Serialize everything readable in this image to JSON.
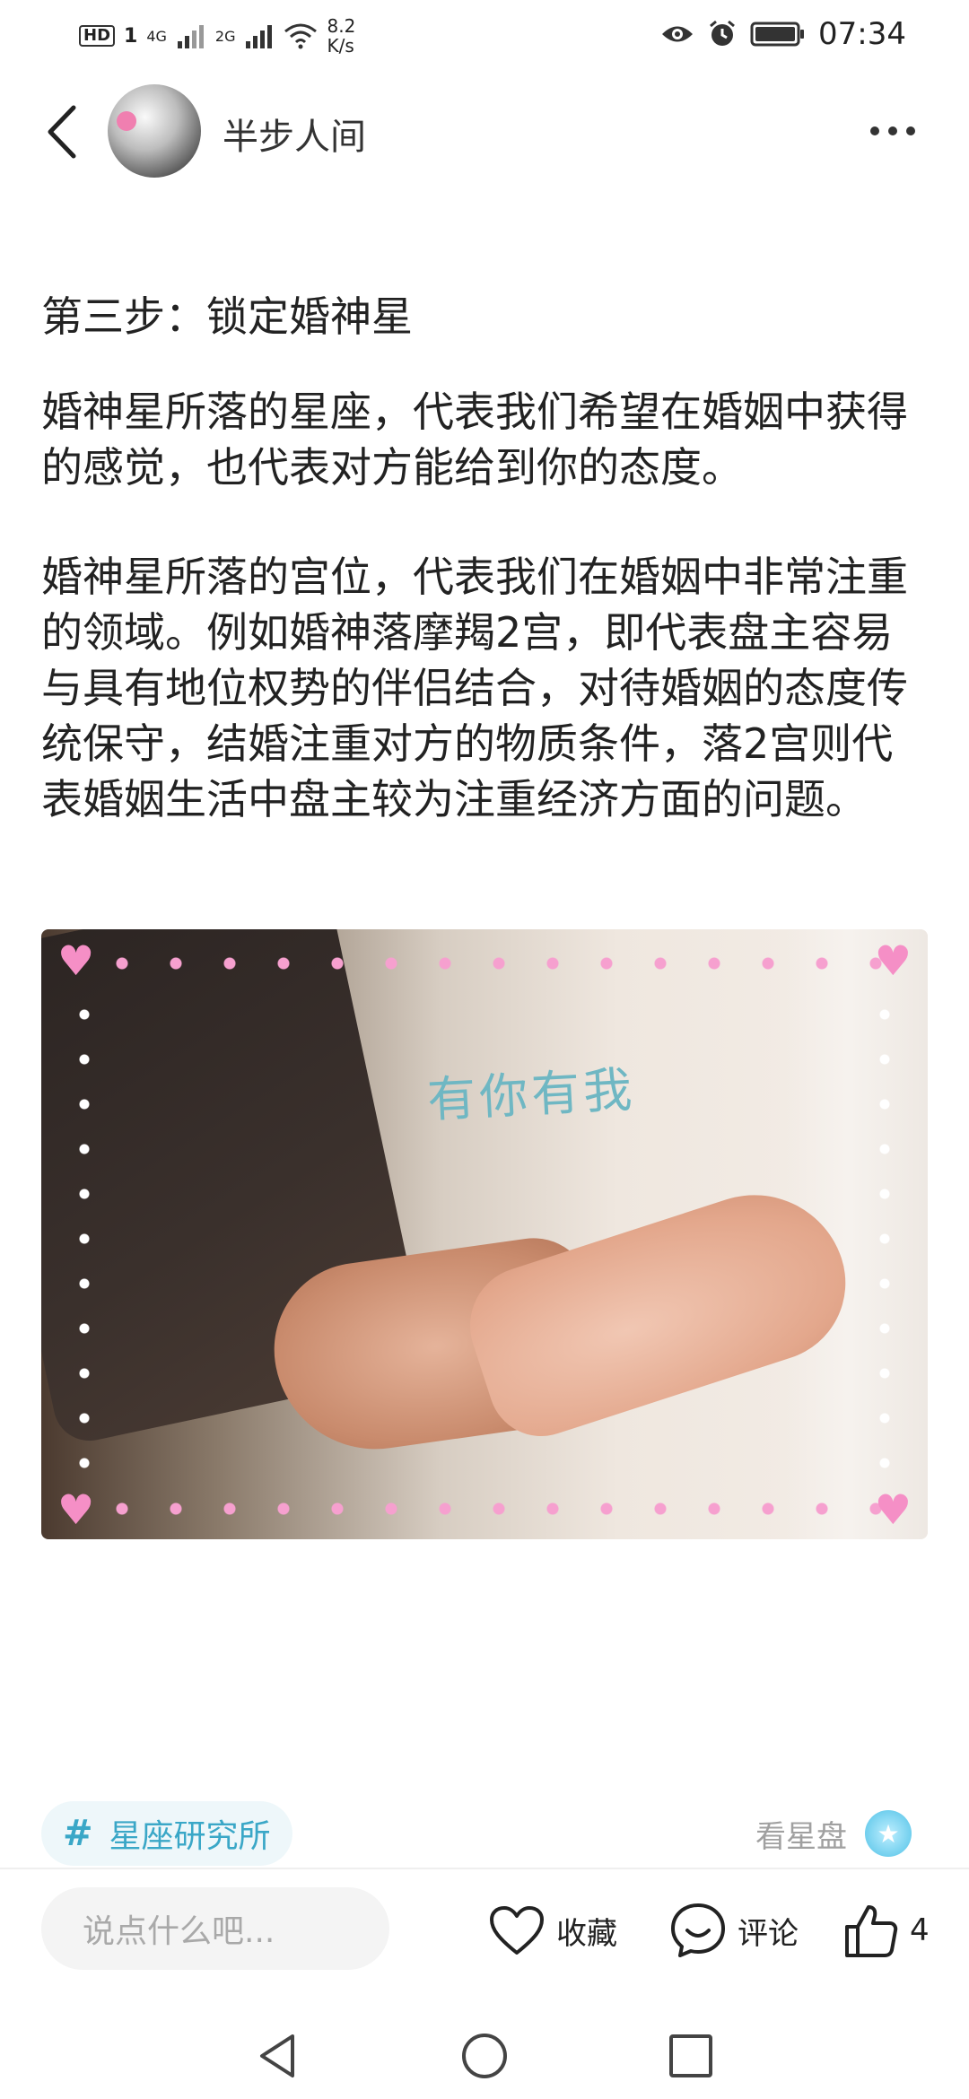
{
  "status_bar": {
    "hd_badge": "HD",
    "sim1_label": "1",
    "signal1_label": "4G",
    "signal2_label": "2G",
    "net_speed_value": "8.2",
    "net_speed_unit": "K/s",
    "time": "07:34",
    "icons": [
      "eye-icon",
      "alarm-icon",
      "battery-icon",
      "wifi-icon",
      "signal-icon"
    ]
  },
  "header": {
    "author_name": "半步人间",
    "icons": [
      "back-arrow-icon",
      "more-dots-icon"
    ]
  },
  "article": {
    "heading": "第三步：锁定婚神星",
    "paragraph1": "婚神星所落的星座，代表我们希望在婚姻中获得的感觉，也代表对方能给到你的态度。",
    "paragraph2": "婚神星所落的宫位，代表我们在婚姻中非常注重的领域。例如婚神落摩羯2宫，即代表盘主容易与具有地位权势的伴侣结合，对待婚姻的态度传统保守，结婚注重对方的物质条件，落2宫则代表婚姻生活中盘主较为注重经济方面的问题。",
    "image_caption_art": "有你有我"
  },
  "tags": {
    "hash": "#",
    "topic": "星座研究所",
    "see_chart_label": "看星盘"
  },
  "bottom_bar": {
    "comment_placeholder": "说点什么吧...",
    "favorite_label": "收藏",
    "comment_label": "评论",
    "like_count": "4"
  },
  "colors": {
    "accent": "#3aa7c7",
    "tag_bg": "#eef7fa",
    "muted_text": "#a0a0a0",
    "input_bg": "#f4f4f4"
  }
}
